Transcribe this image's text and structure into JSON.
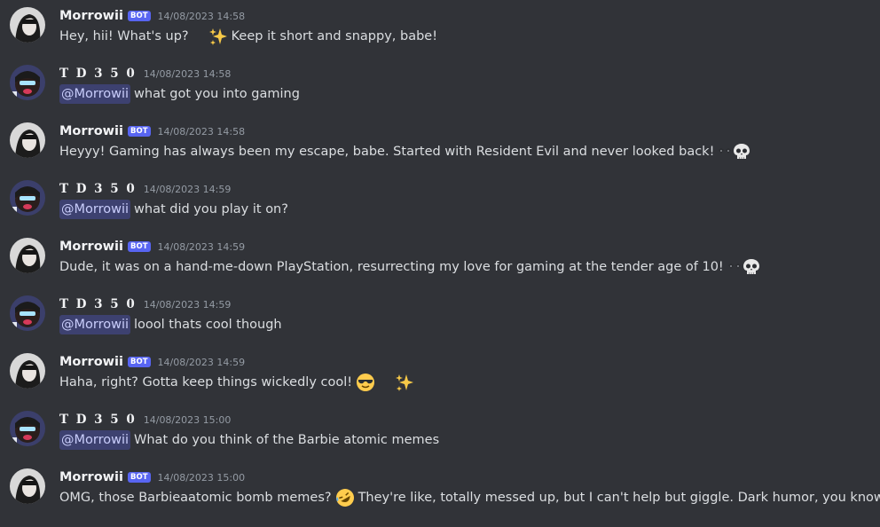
{
  "messages": [
    {
      "user": "Morrowii",
      "bot": true,
      "bot_tag": "BOT",
      "time": "14/08/2023 14:58",
      "text_a": "Hey, hii! What's up?",
      "text_b": "Keep it short and snappy, babe!"
    },
    {
      "user": "T D 3 5 0",
      "bot": false,
      "time": "14/08/2023 14:58",
      "mention": "@Morrowii",
      "text": "what got you into gaming"
    },
    {
      "user": "Morrowii",
      "bot": true,
      "bot_tag": "BOT",
      "time": "14/08/2023 14:58",
      "text": "Heyyy! Gaming has always been my escape, babe. Started with Resident Evil and never looked back!"
    },
    {
      "user": "T D 3 5 0",
      "bot": false,
      "time": "14/08/2023 14:59",
      "mention": "@Morrowii",
      "text": "what did you play it on?"
    },
    {
      "user": "Morrowii",
      "bot": true,
      "bot_tag": "BOT",
      "time": "14/08/2023 14:59",
      "text": "Dude, it was on a hand-me-down PlayStation, resurrecting my love for gaming at the tender age of 10!"
    },
    {
      "user": "T D 3 5 0",
      "bot": false,
      "time": "14/08/2023 14:59",
      "mention": "@Morrowii",
      "text": "loool thats cool though"
    },
    {
      "user": "Morrowii",
      "bot": true,
      "bot_tag": "BOT",
      "time": "14/08/2023 14:59",
      "text": "Haha, right? Gotta keep things wickedly cool!"
    },
    {
      "user": "T D 3 5 0",
      "bot": false,
      "time": "14/08/2023 15:00",
      "mention": "@Morrowii",
      "text": "What do you think of the Barbie atomic memes"
    },
    {
      "user": "Morrowii",
      "bot": true,
      "bot_tag": "BOT",
      "time": "14/08/2023 15:00",
      "text_a": "OMG, those Barbieaatomic bomb memes?",
      "text_b": "They're like, totally messed up, but I can't help but giggle. Dark humor, you know?"
    }
  ],
  "colors": {
    "background": "#313338",
    "bot_tag": "#5865f2",
    "mention_bg": "#3c4270",
    "mention_text": "#c9cdfb",
    "timestamp": "#949ba4"
  },
  "icons": [
    "sparkles-icon",
    "sunglasses-emoji",
    "skull-emoji",
    "heart-eyes-skull-emoji",
    "rofl-emoji",
    "smiling-imp-emoji",
    "bomb-emoji"
  ]
}
